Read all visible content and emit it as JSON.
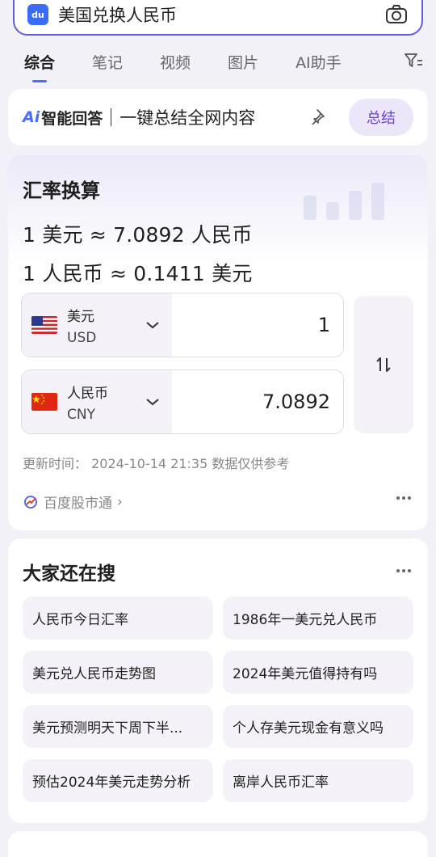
{
  "search": {
    "logo": "du",
    "query": "美国兑换人民币"
  },
  "tabs": [
    {
      "label": "综合",
      "active": true
    },
    {
      "label": "笔记",
      "active": false
    },
    {
      "label": "视频",
      "active": false
    },
    {
      "label": "图片",
      "active": false
    },
    {
      "label": "AI助手",
      "active": false
    }
  ],
  "ai_answer": {
    "mark": "Ai",
    "label": "智能回答",
    "slogan": "一键总结全网内容",
    "summary_button": "总结"
  },
  "exchange": {
    "title": "汇率换算",
    "line1": "1 美元 ≈ 7.0892 人民币",
    "line2": "1 人民币 ≈ 0.1411 美元",
    "from": {
      "name": "美元",
      "code": "USD",
      "value": "1"
    },
    "to": {
      "name": "人民币",
      "code": "CNY",
      "value": "7.0892"
    },
    "update": "更新时间： 2024-10-14 21:35 数据仅供参考",
    "source": "百度股市通"
  },
  "related": {
    "title": "大家还在搜",
    "items": [
      "人民币今日汇率",
      "1986年一美元兑人民币",
      "美元兑人民币走势图",
      "2024年美元值得持有吗",
      "美元预测明天下周下半...",
      "个人存美元现金有意义吗",
      "预估2024年美元走势分析",
      "离岸人民币汇率"
    ]
  },
  "colors": {
    "accent": "#4e6ef2",
    "summary": "#6c3ed6"
  }
}
